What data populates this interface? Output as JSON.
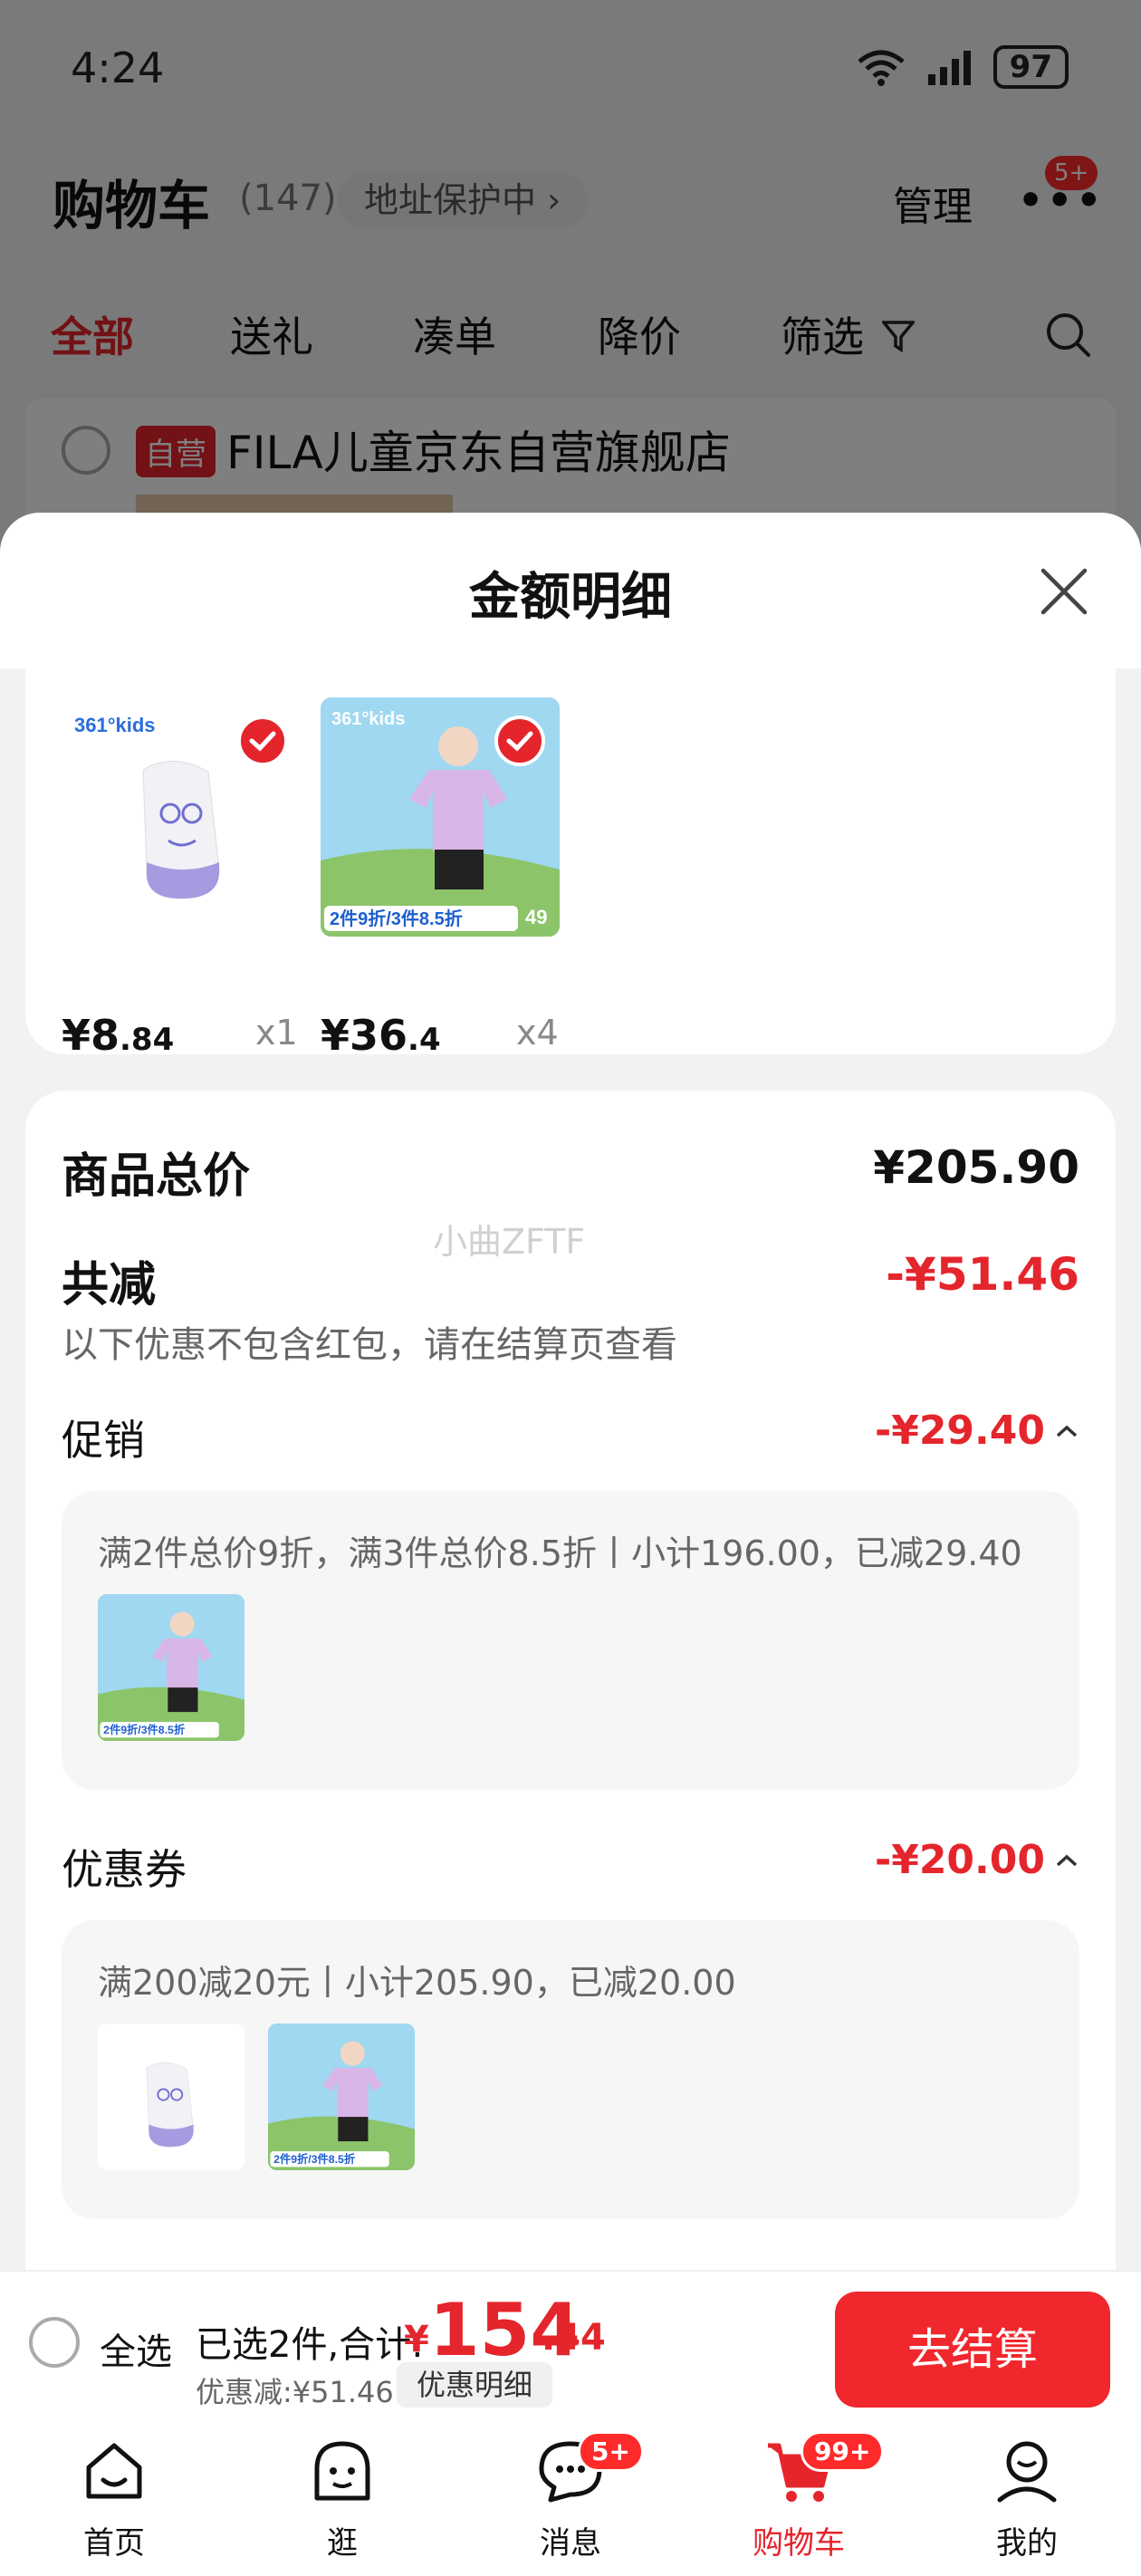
{
  "status_bar": {
    "time": "4:24",
    "battery": "97"
  },
  "cart_header": {
    "title": "购物车",
    "count": "(147)",
    "address_chip": "地址保护中",
    "manage": "管理",
    "badge": "5+"
  },
  "filter_tabs": [
    "全部",
    "送礼",
    "凑单",
    "降价",
    "筛选"
  ],
  "store": {
    "tag": "自营",
    "name": "FILA儿童京东自营旗舰店"
  },
  "modal": {
    "title": "金额明细",
    "items": [
      {
        "price_int": "¥8",
        "price_dec": ".84",
        "qty": "x1",
        "brand": "361°kids"
      },
      {
        "price_int": "¥36",
        "price_dec": ".4",
        "qty": "x4",
        "brand": "361°kids",
        "promo": "2件9折/3件8.5折",
        "promo_num": "49"
      }
    ],
    "summary": {
      "total_label": "商品总价",
      "total_value": "¥205.90",
      "reduced_label": "共减",
      "reduced_value": "-¥51.46",
      "hint": "以下优惠不包含红包，请在结算页查看",
      "watermark": "小曲ZFTF"
    },
    "promotion": {
      "label": "促销",
      "amount": "-¥29.40",
      "desc": "满2件总价9折，满3件总价8.5折丨小计196.00，已减29.40"
    },
    "coupon": {
      "label": "优惠券",
      "amount": "-¥20.00",
      "desc": "满200减20元丨小计205.90，已减20.00"
    }
  },
  "checkout": {
    "select_all": "全选",
    "selected": "已选2件,合计:",
    "currency": "¥",
    "total_int": "154",
    "total_dec": ".44",
    "discount": "优惠减:¥51.46",
    "detail_button": "优惠明细",
    "pay_button": "去结算"
  },
  "bottom_nav": [
    {
      "label": "首页",
      "icon": "home-icon"
    },
    {
      "label": "逛",
      "icon": "browse-icon"
    },
    {
      "label": "消息",
      "icon": "message-icon",
      "badge": "5+"
    },
    {
      "label": "购物车",
      "icon": "cart-icon",
      "badge": "99+"
    },
    {
      "label": "我的",
      "icon": "profile-icon"
    }
  ],
  "colors": {
    "accent": "#e4252c",
    "button": "#f0272d"
  }
}
